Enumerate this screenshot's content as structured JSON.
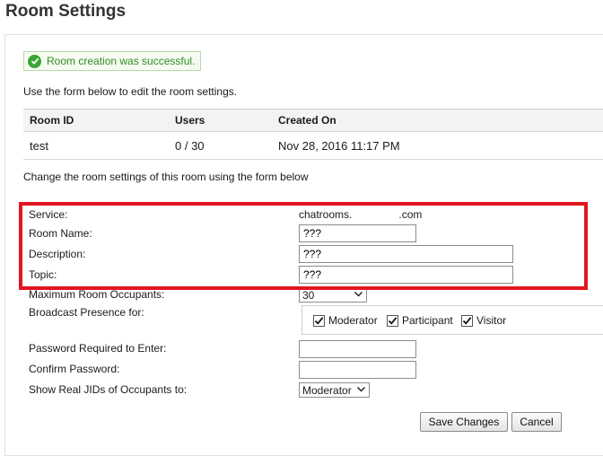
{
  "page": {
    "title": "Room Settings"
  },
  "alert": {
    "message": "Room creation was successful."
  },
  "intro_text": "Use the form below to edit the room settings.",
  "room_table": {
    "headers": [
      "Room ID",
      "Users",
      "Created On"
    ],
    "rows": [
      [
        "test",
        "0 / 30",
        "Nov 28, 2016 11:17 PM"
      ]
    ]
  },
  "change_text": "Change the room settings of this room using the form below",
  "form": {
    "service_label": "Service:",
    "service_value_prefix": "chatrooms.",
    "service_value_suffix": ".com",
    "room_name_label": "Room Name:",
    "room_name_value": "???",
    "description_label": "Description:",
    "description_value": "???",
    "topic_label": "Topic:",
    "topic_value": "???",
    "max_occupants_label": "Maximum Room Occupants:",
    "max_occupants_value": "30",
    "broadcast_label": "Broadcast Presence for:",
    "broadcast_options": [
      {
        "label": "Moderator",
        "checked": true
      },
      {
        "label": "Participant",
        "checked": true
      },
      {
        "label": "Visitor",
        "checked": true
      }
    ],
    "password_label": "Password Required to Enter:",
    "password_value": "",
    "confirm_password_label": "Confirm Password:",
    "confirm_password_value": "",
    "real_jids_label": "Show Real JIDs of Occupants to:",
    "real_jids_value": "Moderator"
  },
  "buttons": {
    "save": "Save Changes",
    "cancel": "Cancel"
  },
  "colors": {
    "highlight": "#e2161f",
    "success_text": "#2e8b1f",
    "success_icon": "#3aa534"
  }
}
